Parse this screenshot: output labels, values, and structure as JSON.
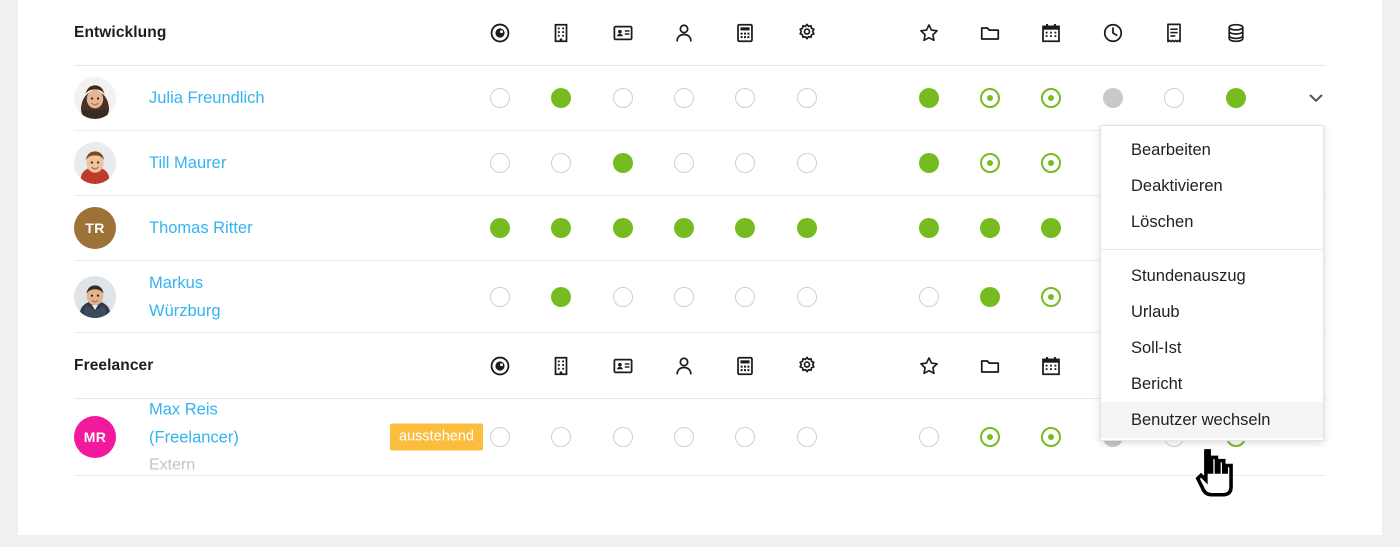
{
  "colors": {
    "accent_green": "#76bc21",
    "link_blue": "#33b4f0",
    "badge_orange": "#fbbd3d",
    "gray_dot": "#c9c9c9",
    "empty_dot_border": "#cfcfcf",
    "avatar_tr": "#9d7238",
    "avatar_mr": "#f3199c",
    "menu_hover": "#f5f5f5"
  },
  "column_icons": [
    {
      "name": "target-icon",
      "label": "Zeiterfassung"
    },
    {
      "name": "building-icon",
      "label": "Unternehmen"
    },
    {
      "name": "id-card-icon",
      "label": "Kontaktdaten"
    },
    {
      "name": "person-icon",
      "label": "Benutzer"
    },
    {
      "name": "calculator-icon",
      "label": "Abrechnung"
    },
    {
      "name": "gear-icon",
      "label": "Einstellungen"
    },
    {
      "name": "star-icon",
      "label": "Favoriten"
    },
    {
      "name": "folder-icon",
      "label": "Projekte"
    },
    {
      "name": "calendar-icon",
      "label": "Kalender"
    },
    {
      "name": "clock-icon",
      "label": "Stunden"
    },
    {
      "name": "receipt-icon",
      "label": "Belege"
    },
    {
      "name": "database-icon",
      "label": "Daten"
    }
  ],
  "groups": [
    {
      "title": "Entwicklung",
      "people": [
        {
          "name": "Julia Freundlich",
          "name_line2": "",
          "sub": "",
          "badge": "",
          "avatar_type": "photo-female-1",
          "initials": "",
          "states": [
            "empty",
            "green",
            "empty",
            "empty",
            "empty",
            "empty",
            "green",
            "ring",
            "ring",
            "gray",
            "empty",
            "green"
          ],
          "has_chevron": true
        },
        {
          "name": "Till Maurer",
          "name_line2": "",
          "sub": "",
          "badge": "",
          "avatar_type": "photo-male-1",
          "initials": "",
          "states": [
            "empty",
            "empty",
            "green",
            "empty",
            "empty",
            "empty",
            "green",
            "ring",
            "ring",
            "",
            "",
            ""
          ],
          "has_chevron": false
        },
        {
          "name": "Thomas Ritter",
          "name_line2": "",
          "sub": "",
          "badge": "",
          "avatar_type": "initials",
          "initials": "TR",
          "states": [
            "green",
            "green",
            "green",
            "green",
            "green",
            "green",
            "green",
            "green",
            "green",
            "",
            "",
            ""
          ],
          "has_chevron": false
        },
        {
          "name": "Markus",
          "name_line2": "Würzburg",
          "sub": "",
          "badge": "",
          "avatar_type": "photo-male-2",
          "initials": "",
          "states": [
            "empty",
            "green",
            "empty",
            "empty",
            "empty",
            "empty",
            "empty",
            "green",
            "ring",
            "",
            "",
            ""
          ],
          "has_chevron": false
        }
      ]
    },
    {
      "title": "Freelancer",
      "people": [
        {
          "name": "Max Reis",
          "name_line2": "(Freelancer)",
          "sub": "Extern",
          "badge": "ausstehend",
          "avatar_type": "initials",
          "initials": "MR",
          "states": [
            "empty",
            "empty",
            "empty",
            "empty",
            "empty",
            "empty",
            "empty",
            "ring",
            "ring",
            "gray",
            "empty",
            "ring"
          ],
          "has_chevron": true
        }
      ]
    }
  ],
  "freelancer_header_icons": 9,
  "menu": {
    "group1": [
      "Bearbeiten",
      "Deaktivieren",
      "Löschen"
    ],
    "group2": [
      "Stundenauszug",
      "Urlaub",
      "Soll-Ist",
      "Bericht",
      "Benutzer wechseln"
    ],
    "active_item": "Benutzer wechseln"
  }
}
